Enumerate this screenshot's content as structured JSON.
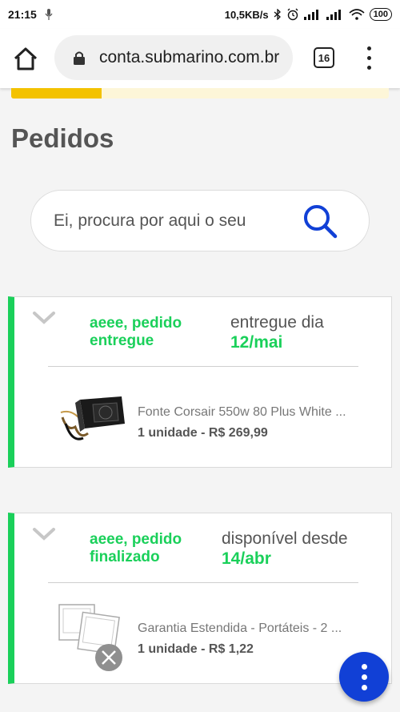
{
  "status_bar": {
    "time": "21:15",
    "network_speed": "10,5KB/s",
    "battery": "100"
  },
  "browser": {
    "url": "conta.submarino.com.br",
    "tab_count": "16"
  },
  "page": {
    "title": "Pedidos",
    "load_progress": 0.24
  },
  "search": {
    "placeholder": "Ei, procura por aqui o seu pedido"
  },
  "orders": [
    {
      "status": "aeee, pedido entregue",
      "date_label": "entregue dia",
      "date_value": "12/mai",
      "product_name": "Fonte Corsair 550w 80 Plus White ...",
      "product_qty_price": "1 unidade - R$ 269,99",
      "thumbnail_icon": "power-supply-image"
    },
    {
      "status": "aeee, pedido finalizado",
      "date_label": "disponível desde",
      "date_value": "14/abr",
      "product_name": "Garantia Estendida - Portáteis - 2 ...",
      "product_qty_price": "1 unidade - R$ 1,22",
      "thumbnail_icon": "image-placeholder-icon"
    }
  ],
  "colors": {
    "accent_green": "#1ad05a",
    "brand_blue": "#1140d6",
    "progress_yellow": "#f3c200"
  }
}
